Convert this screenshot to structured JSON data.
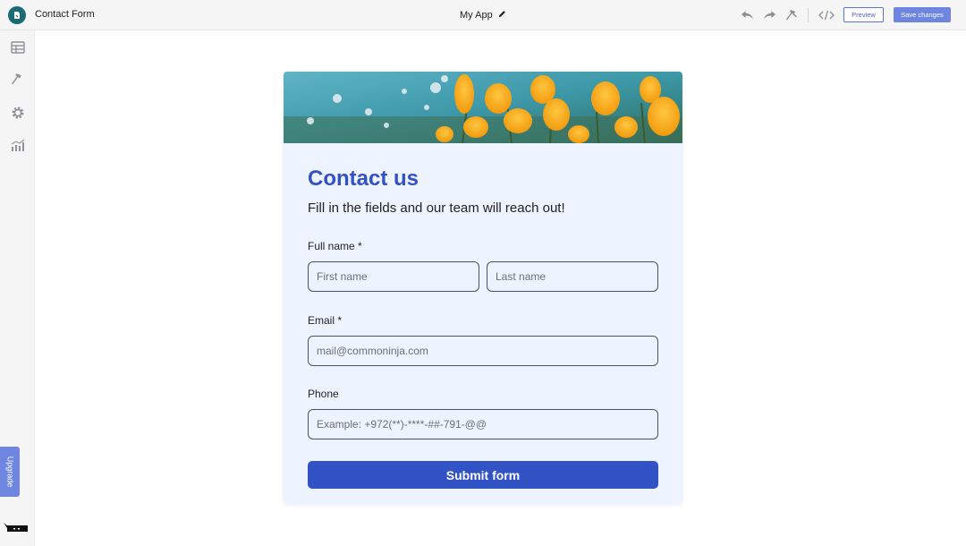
{
  "header": {
    "app_title": "Contact Form",
    "project_name": "My App",
    "preview_label": "Preview",
    "save_label": "Save changes"
  },
  "sidebar": {
    "items": [
      {
        "icon": "table-icon"
      },
      {
        "icon": "hammer-icon"
      },
      {
        "icon": "gear-icon"
      },
      {
        "icon": "analytics-icon"
      }
    ],
    "upgrade_label": "Upgrade"
  },
  "form": {
    "title": "Contact us",
    "subtitle": "Fill in the fields and our team will reach out!",
    "full_name_label": "Full name *",
    "first_name_placeholder": "First name",
    "last_name_placeholder": "Last name",
    "email_label": "Email *",
    "email_placeholder": "mail@commoninja.com",
    "phone_label": "Phone",
    "phone_placeholder": "Example: +972(**)-****-##-791-@@",
    "submit_label": "Submit form"
  },
  "colors": {
    "accent": "#3253c6",
    "card_bg": "#edf4ff",
    "button_light": "#6f86e0"
  }
}
